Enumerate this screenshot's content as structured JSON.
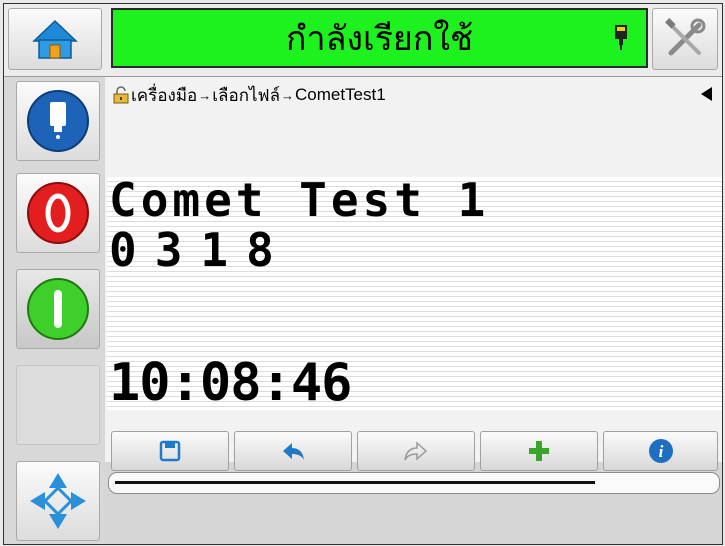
{
  "header": {
    "status_text": "กำลังเรียกใช้",
    "status_color": "#1ef21e"
  },
  "icons": {
    "home": "home-icon",
    "tools": "tools-icon",
    "ink": "ink-cartridge-icon",
    "stop": "stop-icon",
    "start": "start-icon",
    "navigate": "navigation-arrows-icon",
    "save": "save-icon",
    "undo": "undo-icon",
    "redo": "redo-icon",
    "add": "add-icon",
    "info": "info-icon"
  },
  "breadcrumb": {
    "items": [
      "เครื่องมือ",
      "เลือกไฟล์",
      "CometTest1"
    ],
    "separator": "→"
  },
  "message": {
    "line1": "Comet Test 1",
    "line2": "0318",
    "line3": "10:08:46"
  },
  "progress": {
    "value": 0.8
  }
}
